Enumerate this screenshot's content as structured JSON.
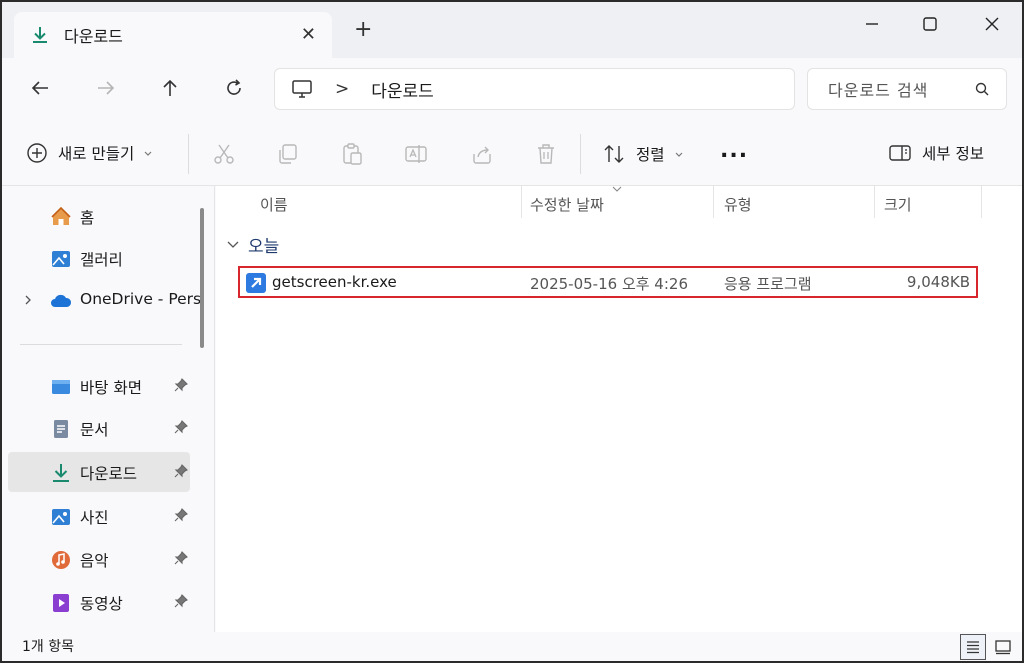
{
  "tab": {
    "title": "다운로드",
    "close": "✕"
  },
  "window": {
    "new_tab": "+"
  },
  "address": {
    "separator": ">",
    "crumb": "다운로드"
  },
  "search": {
    "placeholder": "다운로드 검색"
  },
  "toolbar": {
    "new_label": "새로 만들기",
    "sort_label": "정렬",
    "more": "...",
    "details_label": "세부 정보"
  },
  "sidebar": {
    "items": [
      {
        "label": "홈",
        "icon": "home-icon"
      },
      {
        "label": "갤러리",
        "icon": "gallery-icon"
      },
      {
        "label": "OneDrive - Pers",
        "icon": "onedrive-icon"
      },
      {
        "label": "바탕 화면",
        "icon": "desktop-icon"
      },
      {
        "label": "문서",
        "icon": "documents-icon"
      },
      {
        "label": "다운로드",
        "icon": "download-icon"
      },
      {
        "label": "사진",
        "icon": "pictures-icon"
      },
      {
        "label": "음악",
        "icon": "music-icon"
      },
      {
        "label": "동영상",
        "icon": "videos-icon"
      }
    ]
  },
  "columns": {
    "name": "이름",
    "modified": "수정한 날짜",
    "type": "유형",
    "size": "크기"
  },
  "group": {
    "label": "오늘"
  },
  "files": [
    {
      "name": "getscreen-kr.exe",
      "modified": "2025-05-16 오후 4:26",
      "type": "응용 프로그램",
      "size": "9,048KB"
    }
  ],
  "status": {
    "count": "1개 항목"
  },
  "colors": {
    "accent": "#1a8a6e",
    "highlight": "#d8262d",
    "selected": "#e6e6e6"
  }
}
